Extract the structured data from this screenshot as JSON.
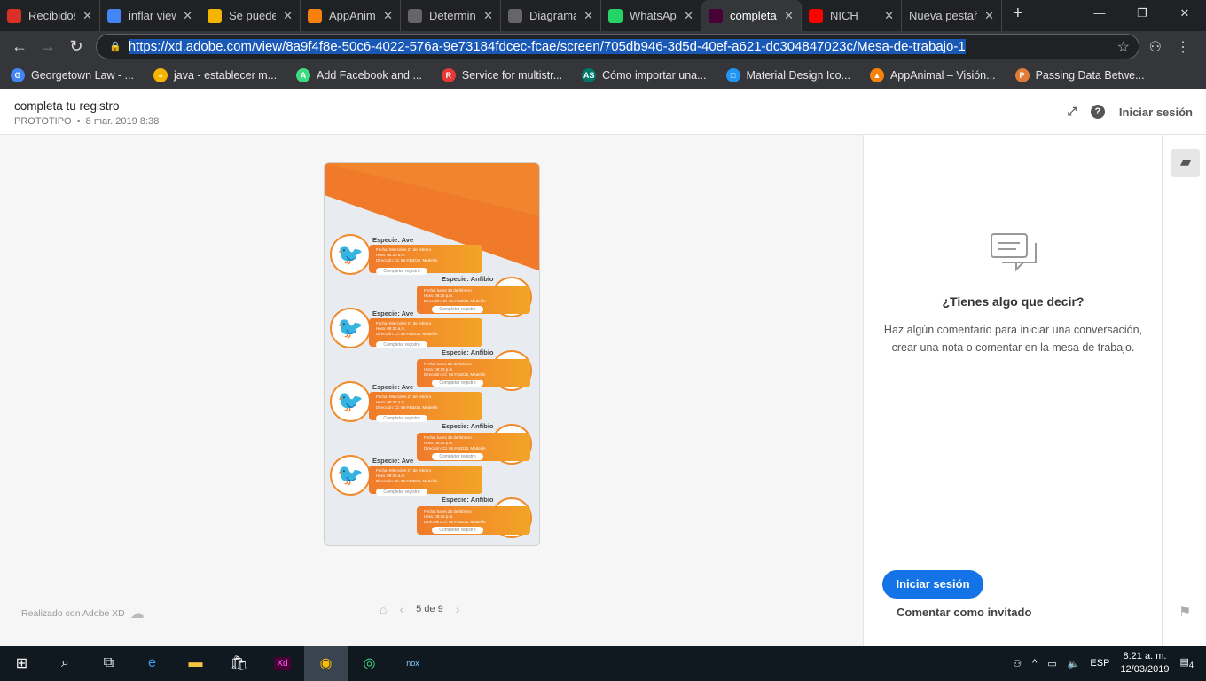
{
  "browser": {
    "tabs": [
      {
        "label": "Recibidos",
        "icon": "gmail-icon",
        "color": "#d93025"
      },
      {
        "label": "inflar view",
        "icon": "google-icon",
        "color": "#4285f4"
      },
      {
        "label": "Se puede",
        "icon": "stackoverflow-icon",
        "color": "#f4b400"
      },
      {
        "label": "AppAnimal",
        "icon": "firebase-icon",
        "color": "#f6820d"
      },
      {
        "label": "Determin",
        "icon": "diagram-icon",
        "color": "#666"
      },
      {
        "label": "Diagrama",
        "icon": "diagram-icon",
        "color": "#666"
      },
      {
        "label": "WhatsApp",
        "icon": "whatsapp-icon",
        "color": "#25d366"
      },
      {
        "label": "completa",
        "icon": "xd-icon",
        "color": "#470137",
        "active": true
      },
      {
        "label": "NICH",
        "icon": "youtube-icon",
        "color": "#ff0000"
      },
      {
        "label": "Nueva pestaña",
        "icon": "",
        "color": ""
      }
    ],
    "url": "https://xd.adobe.com/view/8a9f4f8e-50c6-4022-576a-9e73184fdcec-fcae/screen/705db946-3d5d-40ef-a621-dc304847023c/Mesa-de-trabajo-1",
    "bookmarks": [
      {
        "label": "Georgetown Law - ...",
        "color": "#4285f4",
        "glyph": "G"
      },
      {
        "label": "java - establecer m...",
        "color": "#f4b400",
        "glyph": "≡"
      },
      {
        "label": "Add Facebook and ...",
        "color": "#3ddc84",
        "glyph": "A"
      },
      {
        "label": "Service for multistr...",
        "color": "#e53935",
        "glyph": "R"
      },
      {
        "label": "Cómo importar una...",
        "color": "#00796b",
        "glyph": "AS"
      },
      {
        "label": "Material Design Ico...",
        "color": "#2196f3",
        "glyph": "□"
      },
      {
        "label": "AppAnimal – Visión...",
        "color": "#f6820d",
        "glyph": "▲"
      },
      {
        "label": "Passing Data Betwe...",
        "color": "#e07b39",
        "glyph": "P"
      }
    ]
  },
  "header": {
    "title": "completa tu registro",
    "type": "PROTOTIPO",
    "date": "8 mar. 2019 8:38",
    "signin": "Iniciar sesión"
  },
  "prototype": {
    "cards": [
      {
        "species": "Especie: Ave",
        "date": "Fecha: Miércoles 27 de febrero",
        "time": "Hora: 08:30 a.m.",
        "address": "Dirección: Cl. 58 #45D10, Medellín",
        "button": "Completar registro"
      },
      {
        "species": "Especie: Anfibio",
        "date": "Fecha: lunes 25 de febrero",
        "time": "Hora: 08:30 p.m.",
        "address": "Dirección: Cl. 58 #45D10, Medellín",
        "button": "Completar registro"
      }
    ],
    "accent": "#f08a2a"
  },
  "footer": {
    "made_with": "Realizado con Adobe XD",
    "page": "5 de 9"
  },
  "comments": {
    "question": "¿Tienes algo que decir?",
    "description": "Haz algún comentario para iniciar una conversación, crear una nota o comentar en la mesa de trabajo.",
    "login": "Iniciar sesión",
    "guest": "Comentar como invitado"
  },
  "taskbar": {
    "lang": "ESP",
    "time": "8:21 a. m.",
    "date": "12/03/2019",
    "notifications": "4"
  }
}
